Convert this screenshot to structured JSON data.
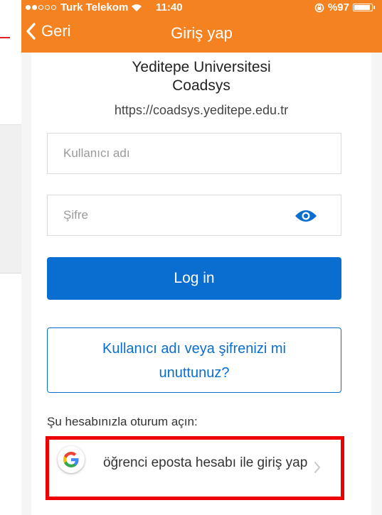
{
  "status_bar": {
    "carrier": "Turk Telekom",
    "time": "11:40",
    "battery_text": "%97",
    "battery_level": 0.97
  },
  "nav": {
    "back_label": "Geri",
    "title": "Giriş yap"
  },
  "login": {
    "org_name_line1": "Yeditepe Universitesi",
    "org_name_line2": "Coadsys",
    "org_url": "https://coadsys.yeditepe.edu.tr",
    "username_placeholder": "Kullanıcı adı",
    "password_placeholder": "Şifre",
    "login_label": "Log in",
    "forgot_line1": "Kullanıcı adı veya şifrenizi mi",
    "forgot_line2": "unuttunuz?",
    "signin_with_label": "Şu hesabınızla oturum açın:",
    "google_label": "öğrenci eposta hesabı ile giriş yap"
  },
  "colors": {
    "brand_orange": "#f58220",
    "primary_blue": "#0a6ed1",
    "highlight_red": "#ee0000"
  }
}
